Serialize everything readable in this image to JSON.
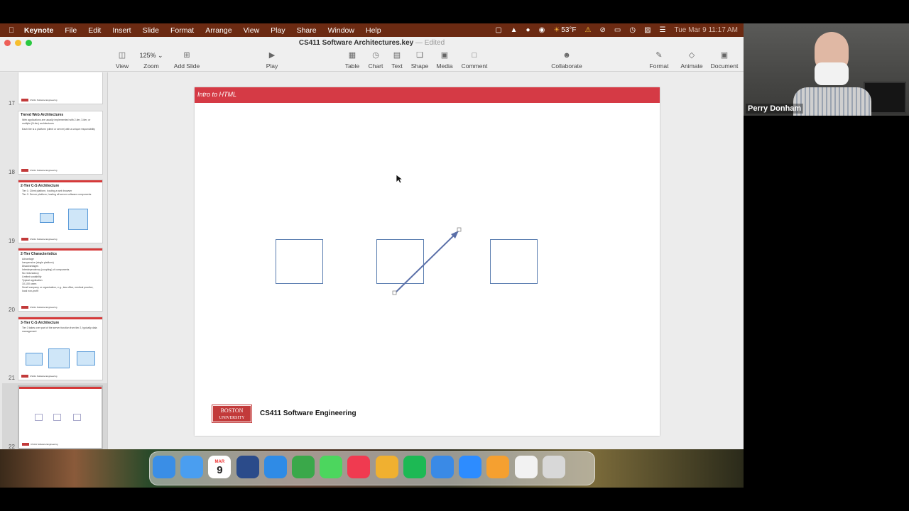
{
  "menubar": {
    "app": "Keynote",
    "items": [
      "File",
      "Edit",
      "Insert",
      "Slide",
      "Format",
      "Arrange",
      "View",
      "Play",
      "Share",
      "Window",
      "Help"
    ],
    "weather": "53°F",
    "clock": "Tue Mar 9  11:17 AM"
  },
  "window": {
    "title": "CS411 Software Architectures.key",
    "title_sep": " — ",
    "edited": "Edited",
    "zoom_value": "125%"
  },
  "toolbar": {
    "view": "View",
    "zoom": "Zoom",
    "add_slide": "Add Slide",
    "play": "Play",
    "table": "Table",
    "chart": "Chart",
    "text": "Text",
    "shape": "Shape",
    "media": "Media",
    "comment": "Comment",
    "collaborate": "Collaborate",
    "format": "Format",
    "animate": "Animate",
    "document": "Document"
  },
  "navigator": {
    "slides": [
      {
        "num": "17",
        "title": "",
        "lines": []
      },
      {
        "num": "18",
        "title": "Tiered Web Architectures",
        "lines": [
          "Web applications are usually implemented with 2-tier, 3-tier, or multiple (N-tier) architectures",
          "Each tier is a platform (client or server) with a unique responsibility"
        ]
      },
      {
        "num": "19",
        "title": "2-Tier C-S Architecture",
        "lines": [
          "Tier 1: Client platform, hosting a web browser",
          "Tier 2: Server platform, hosting all server software components"
        ]
      },
      {
        "num": "20",
        "title": "2-Tier Characteristics",
        "lines": [
          "Advantage",
          "Inexpensive (single platform)",
          "Disadvantages",
          "Interdependency (coupling) of components",
          "No redundancy",
          "Limited scalability",
          "Typical application",
          "10-100 users",
          "Small company or organization, e.g., law office, medical practice, local non-profit"
        ]
      },
      {
        "num": "21",
        "title": "3-Tier C-S Architecture",
        "lines": [
          "Tier 3 takes over part of the server function from tier 2, typically data management"
        ]
      },
      {
        "num": "22",
        "title": "",
        "lines": []
      }
    ],
    "footer_label": "CS411 Software Engineering"
  },
  "slide": {
    "header": "Intro to HTML",
    "logo_line1": "BOSTON",
    "logo_line2": "UNIVERSITY",
    "footer": "CS411 Software Engineering"
  },
  "participant": {
    "name": "Perry Donham"
  },
  "dock": {
    "apps": [
      {
        "name": "Finder",
        "color": "#3a8ee6"
      },
      {
        "name": "Mail",
        "color": "#4a9ef0"
      },
      {
        "name": "Calendar",
        "color": "#ffffff",
        "label_top": "MAR",
        "label": "9"
      },
      {
        "name": "Tasks",
        "color": "#2b4b8a"
      },
      {
        "name": "Safari",
        "color": "#2f8be6"
      },
      {
        "name": "Evernote",
        "color": "#3aa84a"
      },
      {
        "name": "Messages",
        "color": "#4cd65e"
      },
      {
        "name": "Music",
        "color": "#f03a50"
      },
      {
        "name": "Cyberduck",
        "color": "#f0b030"
      },
      {
        "name": "Spotify",
        "color": "#1db954"
      },
      {
        "name": "Keynote",
        "color": "#3a8ae6"
      },
      {
        "name": "Zoom",
        "color": "#2d8cff"
      },
      {
        "name": "Pages",
        "color": "#f5a030"
      },
      {
        "name": "Documents",
        "color": "#f2f2f2"
      },
      {
        "name": "Trash",
        "color": "#d8d8d8"
      }
    ]
  }
}
